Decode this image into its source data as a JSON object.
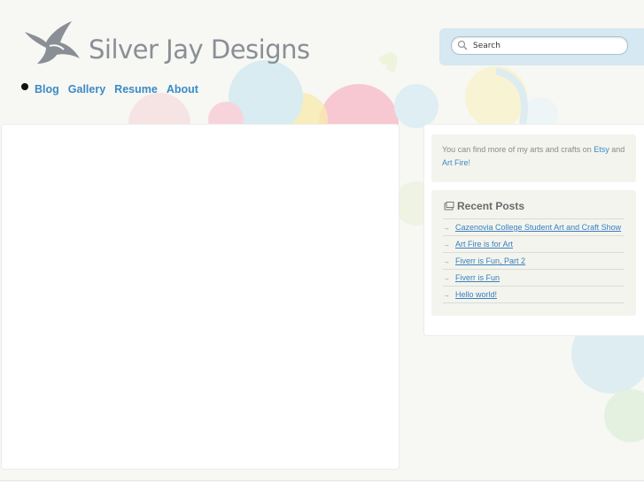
{
  "site": {
    "title": "Silver Jay Designs"
  },
  "search": {
    "placeholder": "Search"
  },
  "nav": {
    "items": [
      {
        "label": "Blog"
      },
      {
        "label": "Gallery"
      },
      {
        "label": "Resume"
      },
      {
        "label": "About"
      }
    ]
  },
  "sidebar": {
    "text_widget": {
      "prefix": "You can find more of my arts and crafts on ",
      "link1": "Etsy",
      "middle": " and ",
      "link2": "Art Fire",
      "suffix": "!"
    },
    "recent_posts": {
      "title": "Recent Posts",
      "items": [
        {
          "label": "Cazenovia College Student Art and Craft Show"
        },
        {
          "label": "Art Fire is for Art"
        },
        {
          "label": "Fiverr is Fun, Part 2"
        },
        {
          "label": "Fiverr is Fun"
        },
        {
          "label": "Hello world!"
        }
      ]
    }
  },
  "colors": {
    "accent": "#3a8bc6",
    "search_panel": "#d6e8f1",
    "widget_bg": "#f3f4ee"
  },
  "icons": {
    "logo": "swallow-bird-icon",
    "search": "magnifier-icon",
    "recent_posts": "posts-icon",
    "nav_bullet": "bullet-icon",
    "list_arrow": "arrow-right-icon"
  }
}
